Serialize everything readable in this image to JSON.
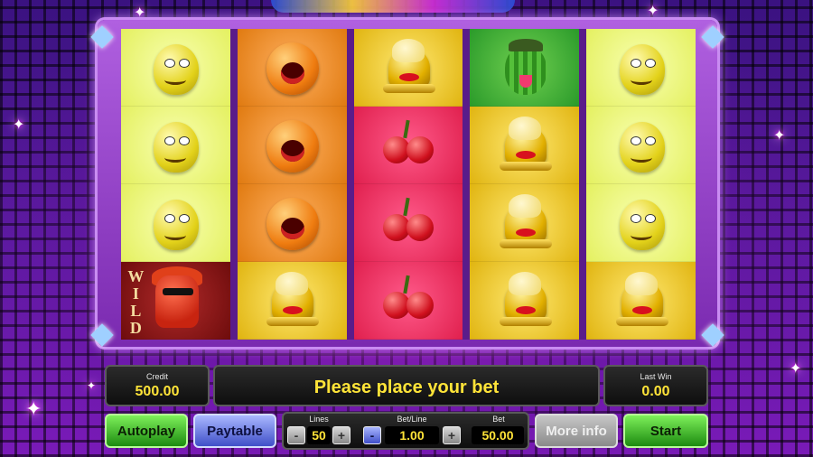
{
  "game": {
    "reels": [
      [
        "lemon",
        "lemon",
        "lemon",
        "wild"
      ],
      [
        "orange",
        "orange",
        "orange",
        "bell"
      ],
      [
        "bell",
        "cherry",
        "cherry",
        "cherry"
      ],
      [
        "melon",
        "bell",
        "bell",
        "bell"
      ],
      [
        "lemon",
        "lemon",
        "lemon",
        "bell"
      ]
    ],
    "wild_label": [
      "W",
      "I",
      "L",
      "D"
    ]
  },
  "info": {
    "credit_label": "Credit",
    "credit_value": "500.00",
    "message": "Please place your bet",
    "last_win_label": "Last Win",
    "last_win_value": "0.00"
  },
  "controls": {
    "autoplay_label": "Autoplay",
    "paytable_label": "Paytable",
    "lines_label": "Lines",
    "lines_value": "50",
    "bet_line_label": "Bet/Line",
    "bet_line_value": "1.00",
    "bet_label": "Bet",
    "bet_value": "50.00",
    "more_info_label": "More info",
    "start_label": "Start",
    "minus_glyph": "-",
    "plus_glyph": "+"
  },
  "colors": {
    "accent_yellow": "#ffe438",
    "button_green": "#2fa81f",
    "button_blue": "#5566dd"
  }
}
